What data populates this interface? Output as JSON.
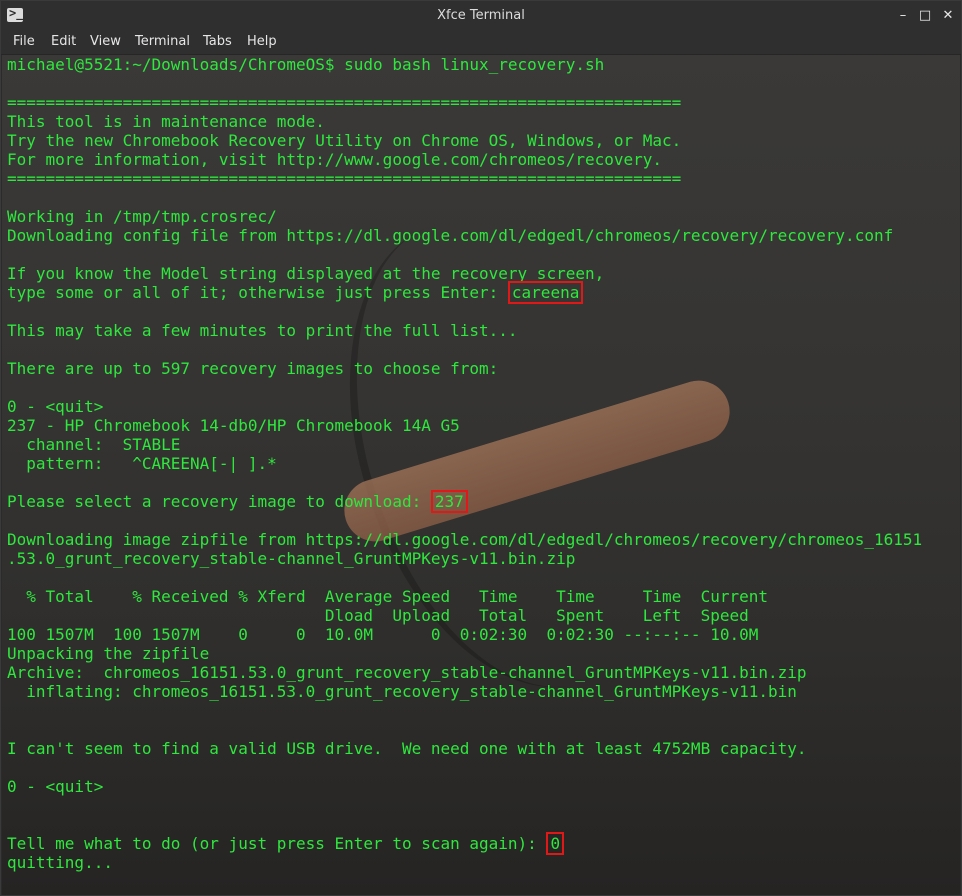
{
  "window": {
    "title": "Xfce Terminal",
    "icon": "terminal-icon",
    "controls": {
      "minimize": "–",
      "maximize": "□",
      "close": "✕"
    }
  },
  "menu": [
    "File",
    "Edit",
    "View",
    "Terminal",
    "Tabs",
    "Help"
  ],
  "terminal": {
    "text_color": "#2ee83d",
    "highlight_color": "#e01818",
    "lines": [
      "michael@5521:~/Downloads/ChromeOS$ sudo bash linux_recovery.sh",
      "",
      "======================================================================",
      "This tool is in maintenance mode.",
      "Try the new Chromebook Recovery Utility on Chrome OS, Windows, or Mac.",
      "For more information, visit http://www.google.com/chromeos/recovery.",
      "======================================================================",
      "",
      "Working in /tmp/tmp.crosrec/",
      "Downloading config file from https://dl.google.com/dl/edgedl/chromeos/recovery/recovery.conf",
      "",
      "If you know the Model string displayed at the recovery screen,",
      "type some or all of it; otherwise just press Enter: ",
      "",
      "This may take a few minutes to print the full list...",
      "",
      "There are up to 597 recovery images to choose from:",
      "",
      "0 - <quit>",
      "237 - HP Chromebook 14-db0/HP Chromebook 14A G5",
      "  channel:  STABLE",
      "  pattern:   ^CAREENA[-| ].*",
      "",
      "Please select a recovery image to download: ",
      "",
      "Downloading image zipfile from https://dl.google.com/dl/edgedl/chromeos/recovery/chromeos_16151",
      ".53.0_grunt_recovery_stable-channel_GruntMPKeys-v11.bin.zip",
      "",
      "  % Total    % Received % Xferd  Average Speed   Time    Time     Time  Current",
      "                                 Dload  Upload   Total   Spent    Left  Speed",
      "100 1507M  100 1507M    0     0  10.0M      0  0:02:30  0:02:30 --:--:-- 10.0M",
      "Unpacking the zipfile",
      "Archive:  chromeos_16151.53.0_grunt_recovery_stable-channel_GruntMPKeys-v11.bin.zip",
      "  inflating: chromeos_16151.53.0_grunt_recovery_stable-channel_GruntMPKeys-v11.bin",
      "",
      "",
      "I can't seem to find a valid USB drive.  We need one with at least 4752MB capacity.",
      "",
      "0 - <quit>",
      "",
      "",
      "Tell me what to do (or just press Enter to scan again): ",
      "quitting..."
    ],
    "inputs": {
      "model": {
        "line": 12,
        "value": "careena"
      },
      "image": {
        "line": 23,
        "value": "237"
      },
      "action": {
        "line": 41,
        "value": "0"
      }
    }
  }
}
